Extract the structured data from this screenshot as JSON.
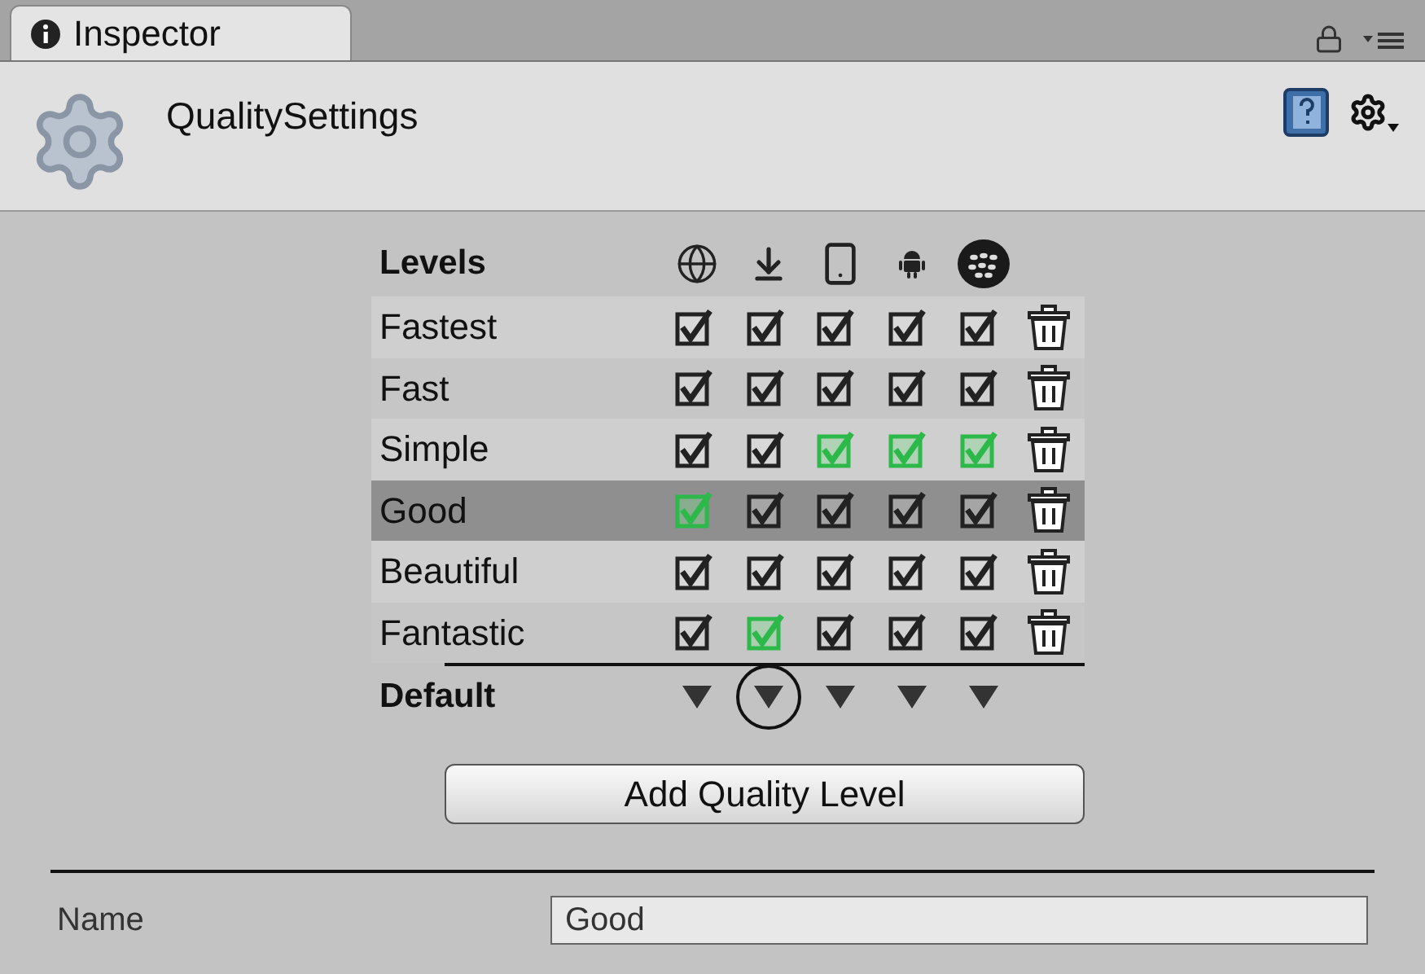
{
  "tab": {
    "title": "Inspector"
  },
  "header": {
    "title": "QualitySettings"
  },
  "levels": {
    "heading": "Levels",
    "platforms": [
      {
        "kind": "globe"
      },
      {
        "kind": "download"
      },
      {
        "kind": "phone"
      },
      {
        "kind": "robot"
      },
      {
        "kind": "dots"
      }
    ],
    "rows": [
      {
        "name": "Fastest",
        "selected": false,
        "checks": [
          {
            "checked": true,
            "is_default": false
          },
          {
            "checked": true,
            "is_default": false
          },
          {
            "checked": true,
            "is_default": false
          },
          {
            "checked": true,
            "is_default": false
          },
          {
            "checked": true,
            "is_default": false
          }
        ]
      },
      {
        "name": "Fast",
        "selected": false,
        "checks": [
          {
            "checked": true,
            "is_default": false
          },
          {
            "checked": true,
            "is_default": false
          },
          {
            "checked": true,
            "is_default": false
          },
          {
            "checked": true,
            "is_default": false
          },
          {
            "checked": true,
            "is_default": false
          }
        ]
      },
      {
        "name": "Simple",
        "selected": false,
        "checks": [
          {
            "checked": true,
            "is_default": false
          },
          {
            "checked": true,
            "is_default": false
          },
          {
            "checked": true,
            "is_default": true
          },
          {
            "checked": true,
            "is_default": true
          },
          {
            "checked": true,
            "is_default": true
          }
        ]
      },
      {
        "name": "Good",
        "selected": true,
        "checks": [
          {
            "checked": true,
            "is_default": true
          },
          {
            "checked": true,
            "is_default": false
          },
          {
            "checked": true,
            "is_default": false
          },
          {
            "checked": true,
            "is_default": false
          },
          {
            "checked": true,
            "is_default": false
          }
        ]
      },
      {
        "name": "Beautiful",
        "selected": false,
        "checks": [
          {
            "checked": true,
            "is_default": false
          },
          {
            "checked": true,
            "is_default": false
          },
          {
            "checked": true,
            "is_default": false
          },
          {
            "checked": true,
            "is_default": false
          },
          {
            "checked": true,
            "is_default": false
          }
        ]
      },
      {
        "name": "Fantastic",
        "selected": false,
        "checks": [
          {
            "checked": true,
            "is_default": false
          },
          {
            "checked": true,
            "is_default": true
          },
          {
            "checked": true,
            "is_default": false
          },
          {
            "checked": true,
            "is_default": false
          },
          {
            "checked": true,
            "is_default": false
          }
        ]
      }
    ],
    "default_label": "Default",
    "default_dropdowns": [
      {
        "circled": false
      },
      {
        "circled": true
      },
      {
        "circled": false
      },
      {
        "circled": false
      },
      {
        "circled": false
      }
    ]
  },
  "add_button": "Add Quality Level",
  "name_field": {
    "label": "Name",
    "value": "Good"
  }
}
